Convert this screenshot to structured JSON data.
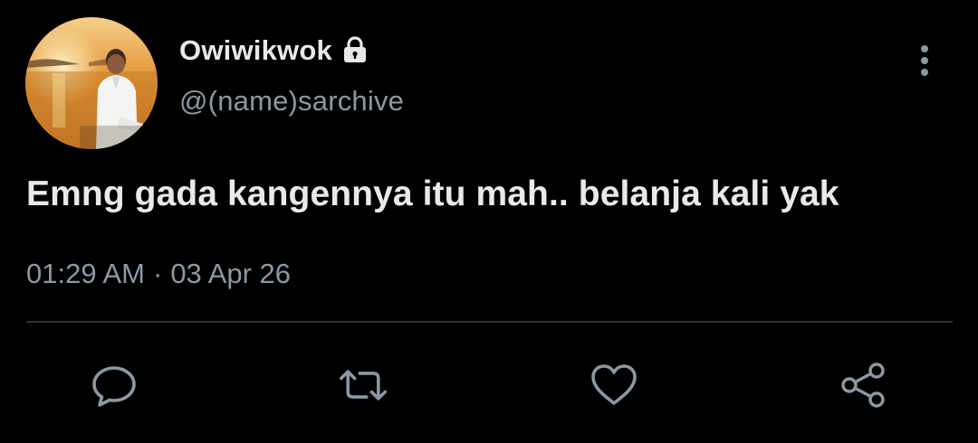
{
  "tweet": {
    "display_name": "Owiwikwok",
    "handle": "@(name)sarchive",
    "text": "Emng gada kangennya itu mah.. belanja kali yak",
    "time": "01:29 AM",
    "separator": "·",
    "date": "03 Apr 26",
    "protected_icon": "lock-icon",
    "more_icon": "more-vertical-icon"
  },
  "actions": [
    {
      "icon": "reply-icon"
    },
    {
      "icon": "retweet-icon"
    },
    {
      "icon": "like-icon"
    },
    {
      "icon": "share-icon"
    }
  ],
  "colors": {
    "background": "#000000",
    "primary_text": "#e7e9ea",
    "secondary_text": "#8b98a5",
    "divider": "#2f3336"
  }
}
